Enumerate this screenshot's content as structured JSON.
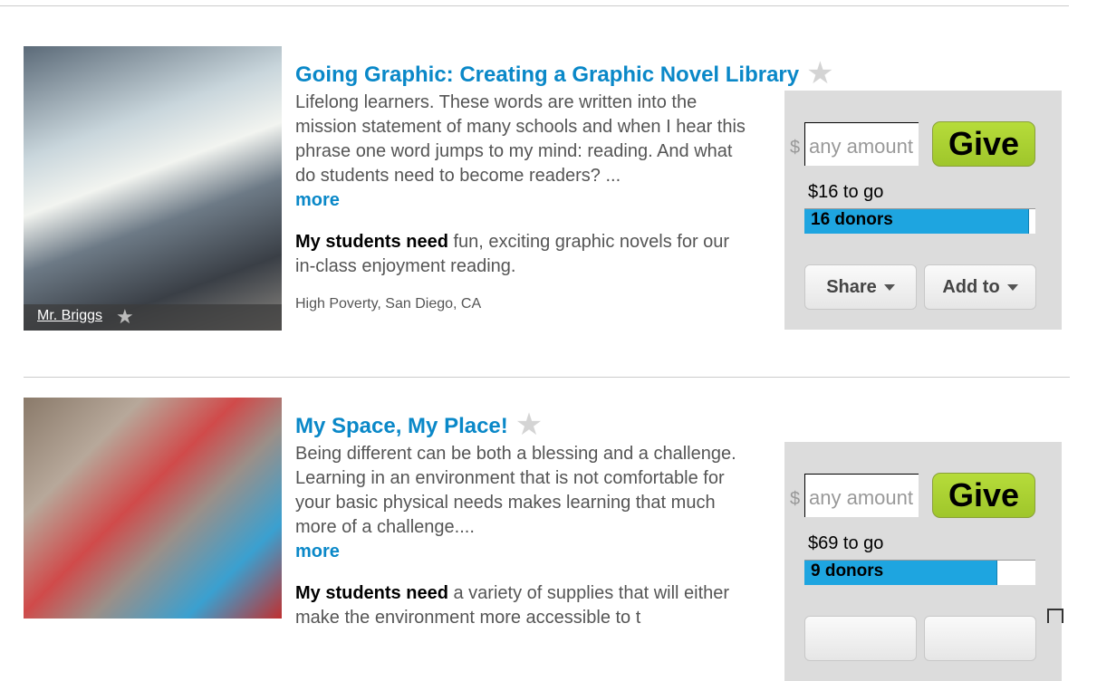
{
  "projects": [
    {
      "title": "Going Graphic: Creating a Graphic Novel Library",
      "teacher": "Mr. Briggs",
      "description": "Lifelong learners. These words are written into the mission statement of many schools and when I hear this phrase one word jumps to my mind: reading. And what do students need to become readers? ...",
      "more": "more",
      "need_label": "My students need",
      "need_text": " fun, exciting graphic novels for our in-class enjoyment reading.",
      "location": "High Poverty, San Diego, CA",
      "currency": "$",
      "amount_placeholder": "any amount",
      "give": "Give",
      "to_go": "$16 to go",
      "donors": "16 donors",
      "progress_percent": 97,
      "share": "Share",
      "add_to": "Add to"
    },
    {
      "title": "My Space, My Place!",
      "description": "Being different can be both a blessing and a challenge. Learning in an environment that is not comfortable for your basic physical needs makes learning that much more of a challenge....",
      "more": "more",
      "need_label": "My students need",
      "need_text": " a variety of supplies that will either make the environment more accessible to t",
      "currency": "$",
      "amount_placeholder": "any amount",
      "give": "Give",
      "to_go": "$69 to go",
      "donors": "9 donors",
      "progress_percent": 83
    }
  ],
  "colors": {
    "link": "#0a88c8",
    "give": "#a8d032",
    "progress": "#1ea5e0",
    "panel": "#dcdcdc"
  }
}
